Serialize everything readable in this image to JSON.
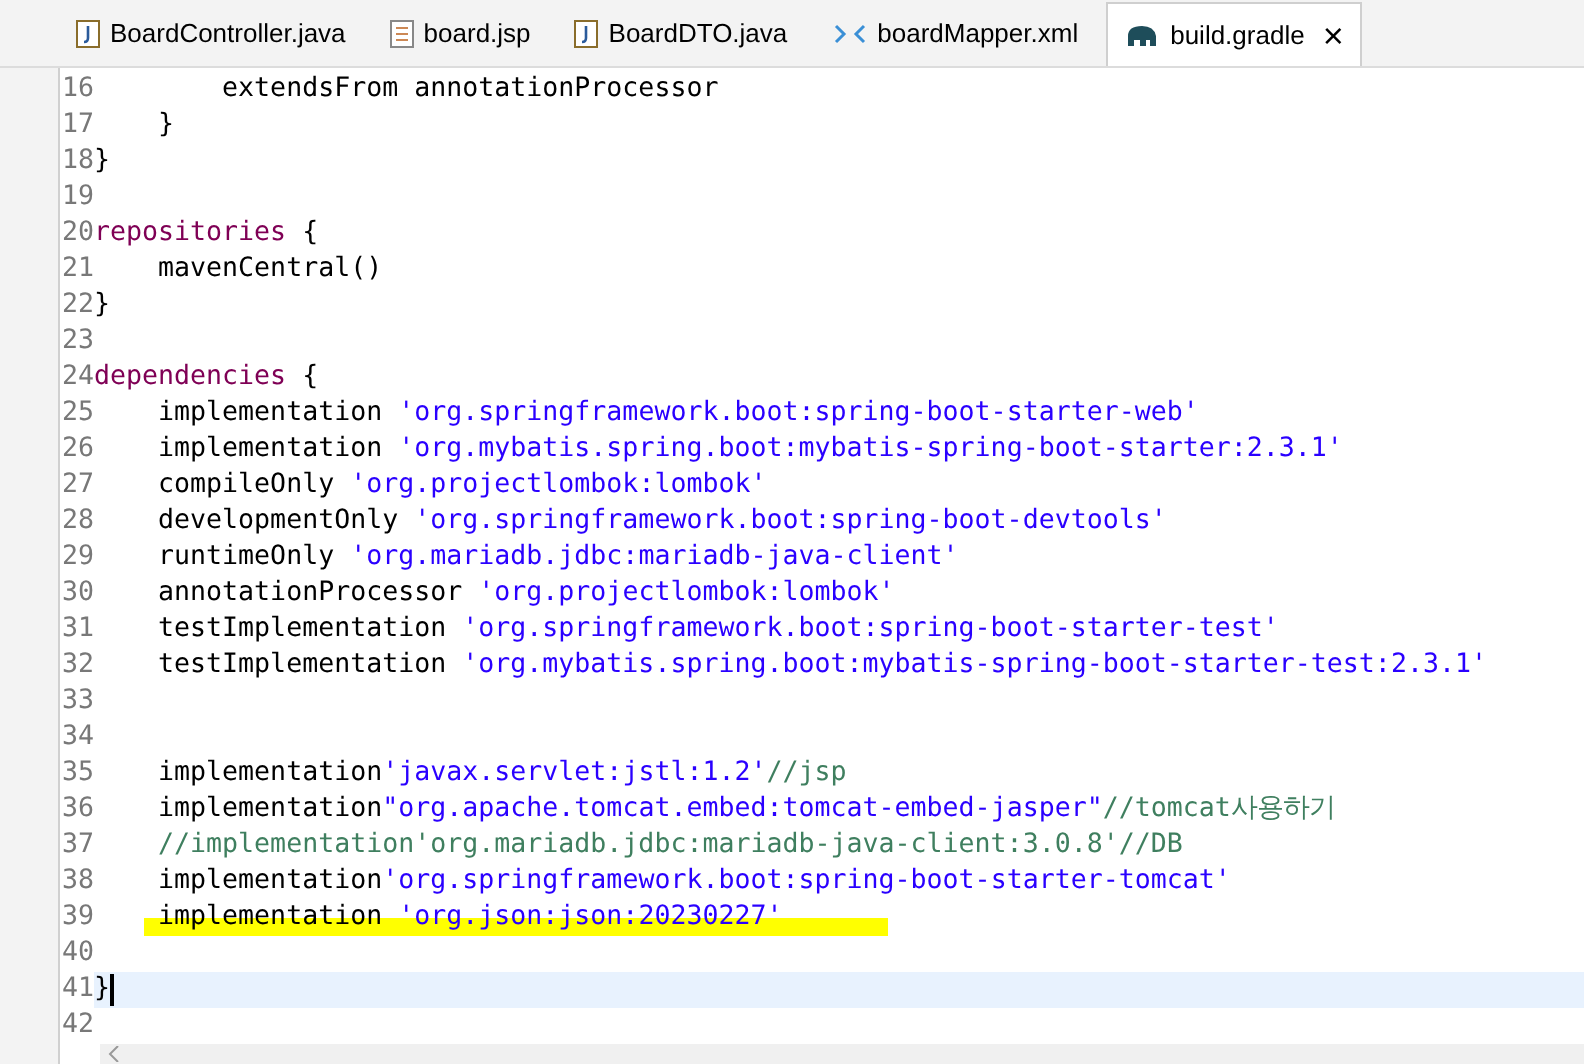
{
  "tabs": [
    {
      "label": "BoardController.java",
      "kind": "java",
      "selected": false
    },
    {
      "label": "board.jsp",
      "kind": "jsp",
      "selected": false
    },
    {
      "label": "BoardDTO.java",
      "kind": "java",
      "selected": false
    },
    {
      "label": "boardMapper.xml",
      "kind": "xml",
      "selected": false
    },
    {
      "label": "build.gradle",
      "kind": "gradle",
      "selected": true,
      "close": "×"
    }
  ],
  "lines": [
    {
      "number": "16",
      "tokens": [
        {
          "kind": "plain",
          "text": "        extendsFrom annotationProcessor"
        }
      ]
    },
    {
      "number": "17",
      "tokens": [
        {
          "kind": "plain",
          "text": "    }"
        }
      ]
    },
    {
      "number": "18",
      "tokens": [
        {
          "kind": "plain",
          "text": "}"
        }
      ]
    },
    {
      "number": "19"
    },
    {
      "number": "20",
      "tokens": [
        {
          "kind": "keyword",
          "text": "repositories"
        },
        {
          "kind": "plain",
          "text": " {"
        }
      ]
    },
    {
      "number": "21",
      "tokens": [
        {
          "kind": "plain",
          "text": "    mavenCentral()"
        }
      ]
    },
    {
      "number": "22",
      "tokens": [
        {
          "kind": "plain",
          "text": "}"
        }
      ]
    },
    {
      "number": "23"
    },
    {
      "number": "24",
      "tokens": [
        {
          "kind": "keyword",
          "text": "dependencies"
        },
        {
          "kind": "plain",
          "text": " {"
        }
      ]
    },
    {
      "number": "25",
      "tokens": [
        {
          "kind": "plain",
          "text": "    implementation "
        },
        {
          "kind": "string",
          "text": "'org.springframework.boot:spring-boot-starter-web'"
        }
      ]
    },
    {
      "number": "26",
      "tokens": [
        {
          "kind": "plain",
          "text": "    implementation "
        },
        {
          "kind": "string",
          "text": "'org.mybatis.spring.boot:mybatis-spring-boot-starter:2.3.1'"
        }
      ]
    },
    {
      "number": "27",
      "tokens": [
        {
          "kind": "plain",
          "text": "    compileOnly "
        },
        {
          "kind": "string",
          "text": "'org.projectlombok:lombok'"
        }
      ]
    },
    {
      "number": "28",
      "tokens": [
        {
          "kind": "plain",
          "text": "    developmentOnly "
        },
        {
          "kind": "string",
          "text": "'org.springframework.boot:spring-boot-devtools'"
        }
      ]
    },
    {
      "number": "29",
      "tokens": [
        {
          "kind": "plain",
          "text": "    runtimeOnly "
        },
        {
          "kind": "string",
          "text": "'org.mariadb.jdbc:mariadb-java-client'"
        }
      ]
    },
    {
      "number": "30",
      "tokens": [
        {
          "kind": "plain",
          "text": "    annotationProcessor "
        },
        {
          "kind": "string",
          "text": "'org.projectlombok:lombok'"
        }
      ]
    },
    {
      "number": "31",
      "tokens": [
        {
          "kind": "plain",
          "text": "    testImplementation "
        },
        {
          "kind": "string",
          "text": "'org.springframework.boot:spring-boot-starter-test'"
        }
      ]
    },
    {
      "number": "32",
      "tokens": [
        {
          "kind": "plain",
          "text": "    testImplementation "
        },
        {
          "kind": "string",
          "text": "'org.mybatis.spring.boot:mybatis-spring-boot-starter-test:2.3.1'"
        }
      ]
    },
    {
      "number": "33"
    },
    {
      "number": "34"
    },
    {
      "number": "35",
      "tokens": [
        {
          "kind": "plain",
          "text": "    implementation"
        },
        {
          "kind": "string",
          "text": "'javax.servlet:jstl:1.2'"
        },
        {
          "kind": "comment",
          "text": "//jsp"
        }
      ]
    },
    {
      "number": "36",
      "tokens": [
        {
          "kind": "plain",
          "text": "    implementation"
        },
        {
          "kind": "string",
          "text": "\"org.apache.tomcat.embed:tomcat-embed-jasper\""
        },
        {
          "kind": "comment",
          "text": "//tomcat사용하기"
        }
      ]
    },
    {
      "number": "37",
      "tokens": [
        {
          "kind": "comment",
          "text": "    //implementation'org.mariadb.jdbc:mariadb-java-client:3.0.8'//DB"
        }
      ]
    },
    {
      "number": "38",
      "tokens": [
        {
          "kind": "plain",
          "text": "    implementation"
        },
        {
          "kind": "string",
          "text": "'org.springframework.boot:spring-boot-starter-tomcat'"
        }
      ]
    },
    {
      "number": "39",
      "highlighted": true,
      "tokens": [
        {
          "kind": "plain",
          "text": "    implementation "
        },
        {
          "kind": "string",
          "text": "'org.json:json:20230227'"
        }
      ]
    },
    {
      "number": "40"
    },
    {
      "number": "41",
      "current": true,
      "tokens": [
        {
          "kind": "plain",
          "text": "}"
        }
      ]
    },
    {
      "number": "42"
    }
  ]
}
